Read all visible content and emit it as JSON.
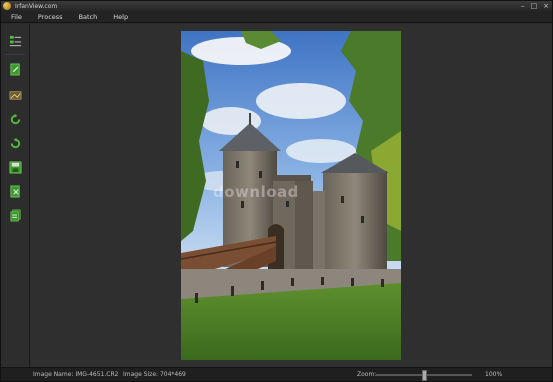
{
  "window": {
    "title": "IrfanView.com",
    "controls": [
      "–",
      "□",
      "×"
    ]
  },
  "menu": {
    "items": [
      "File",
      "Process",
      "Batch",
      "Help"
    ]
  },
  "toolbar": {
    "buttons": [
      {
        "icon": "thumbnails-icon"
      },
      {
        "icon": "edit-document-icon"
      },
      {
        "icon": "process-image-icon"
      },
      {
        "icon": "rotate-right-icon"
      },
      {
        "icon": "rotate-left-icon"
      },
      {
        "icon": "save-icon"
      },
      {
        "icon": "export-icon"
      },
      {
        "icon": "batch-icon"
      }
    ]
  },
  "image": {
    "watermark": "download"
  },
  "status": {
    "image_name": "Image Name: IMG-4651.CR2",
    "image_size": "Image Size: 704*469",
    "zoom_label": "Zoom:",
    "zoom_value": "100%",
    "zoom_level": 0.5
  },
  "colors": {
    "accent_green": "#4fbf3a",
    "background": "#2f2f2f"
  }
}
